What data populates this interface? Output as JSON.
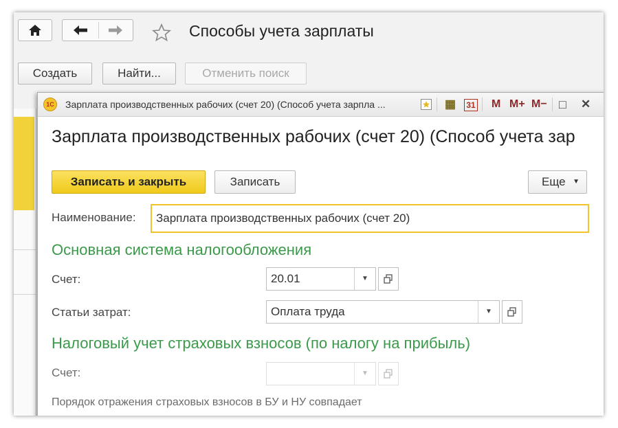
{
  "window": {
    "title": "Способы учета зарплаты"
  },
  "nav": {
    "home_icon": "home-icon",
    "back_icon": "arrow-left-icon",
    "forward_icon": "arrow-right-icon",
    "favorite_icon": "star-icon"
  },
  "toolbar": {
    "create_label": "Создать",
    "find_label": "Найти...",
    "cancel_search_label": "Отменить поиск"
  },
  "dialog": {
    "titlebar_text": "Зарплата производственных рабочих (счет 20) (Способ учета зарпла ...",
    "logo_text": "1С",
    "header_title": "Зарплата производственных рабочих (счет 20) (Способ учета зар",
    "icons": {
      "calculator": "▦",
      "calendar": "31",
      "m": "M",
      "m_plus": "M+",
      "m_minus": "M−",
      "maximize": "□",
      "close": "✕"
    }
  },
  "form": {
    "save_close_label": "Записать и закрыть",
    "save_label": "Записать",
    "more_label": "Еще",
    "name_label": "Наименование:",
    "name_value": "Зарплата производственных рабочих (счет 20)",
    "section_main": "Основная система налогообложения",
    "account_label": "Счет:",
    "account_value": "20.01",
    "cost_items_label": "Статьи затрат:",
    "cost_items_value": "Оплата труда",
    "section_tax": "Налоговый учет страховых взносов (по налогу на прибыль)",
    "tax_account_label": "Счет:",
    "tax_account_value": "",
    "note_text": "Порядок отражения страховых взносов в БУ и НУ совпадает"
  },
  "colors": {
    "accent_yellow": "#f2c42a",
    "section_green": "#3a9a4a"
  }
}
